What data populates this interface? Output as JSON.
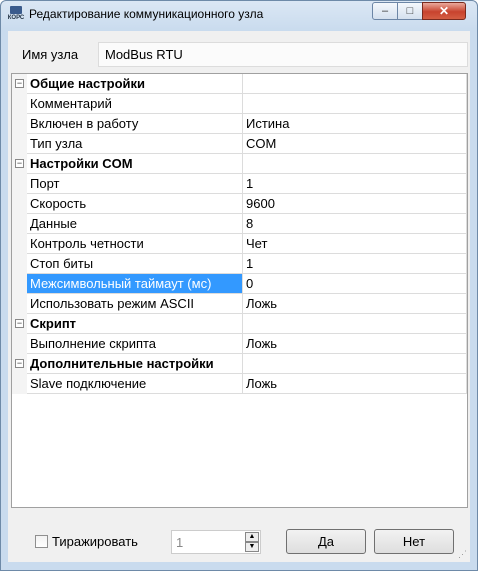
{
  "window": {
    "title": "Редактирование  коммуникационного узла",
    "icon_text": "КОРС",
    "buttons": {
      "minimize": "–",
      "maximize": "□",
      "close": "✕"
    }
  },
  "node_name": {
    "label": "Имя узла",
    "value": "ModBus RTU"
  },
  "grid": {
    "rows": [
      {
        "kind": "category",
        "name": "Общие настройки",
        "value": "",
        "toggle": "−"
      },
      {
        "kind": "prop",
        "name": "Комментарий",
        "value": ""
      },
      {
        "kind": "prop",
        "name": "Включен в работу",
        "value": "Истина"
      },
      {
        "kind": "prop",
        "name": "Тип узла",
        "value": "COM"
      },
      {
        "kind": "category",
        "name": "Настройки COM",
        "value": "",
        "toggle": "−"
      },
      {
        "kind": "prop",
        "name": "Порт",
        "value": "1"
      },
      {
        "kind": "prop",
        "name": "Скорость",
        "value": "9600"
      },
      {
        "kind": "prop",
        "name": "Данные",
        "value": "8"
      },
      {
        "kind": "prop",
        "name": "Контроль четности",
        "value": "Чет"
      },
      {
        "kind": "prop",
        "name": "Стоп биты",
        "value": "1"
      },
      {
        "kind": "prop",
        "name": "Межсимвольный таймаут (мс)",
        "value": "0",
        "selected": true
      },
      {
        "kind": "prop",
        "name": "Использовать режим ASCII",
        "value": "Ложь"
      },
      {
        "kind": "category",
        "name": "Скрипт",
        "value": "",
        "toggle": "−"
      },
      {
        "kind": "prop",
        "name": "Выполнение скрипта",
        "value": "Ложь"
      },
      {
        "kind": "category",
        "name": "Дополнительные настройки",
        "value": "",
        "toggle": "−"
      },
      {
        "kind": "prop",
        "name": "Slave подключение",
        "value": "Ложь"
      }
    ]
  },
  "footer": {
    "replicate_label": "Тиражировать",
    "replicate_checked": false,
    "count_value": "1",
    "yes_label": "Да",
    "no_label": "Нет"
  },
  "colors": {
    "selection": "#3399ff",
    "title_gradient": "#c9dbee",
    "close_button": "#c8432e"
  }
}
